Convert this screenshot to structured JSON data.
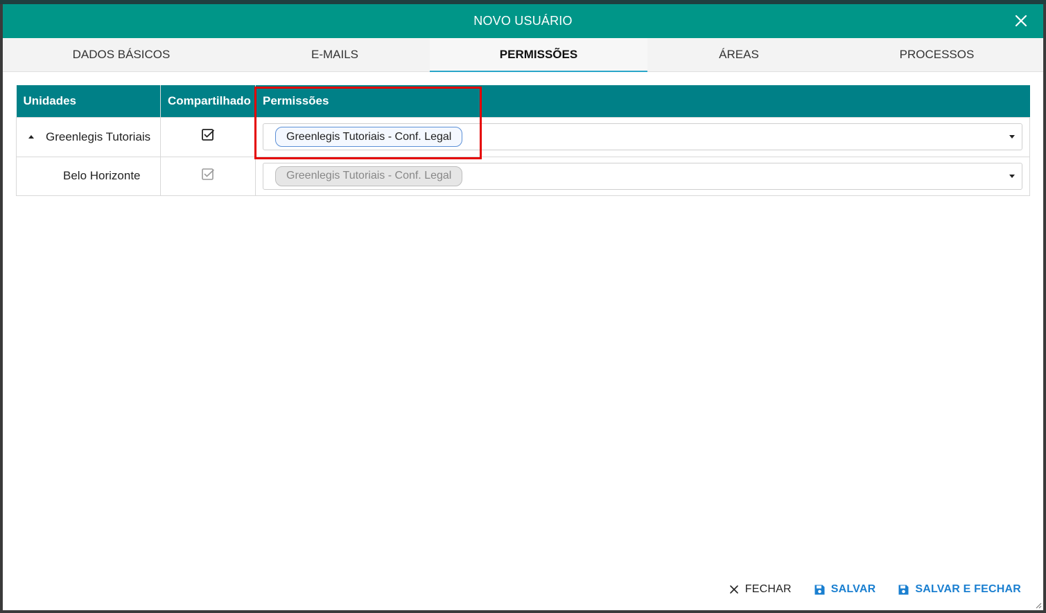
{
  "dialog": {
    "title": "NOVO USUÁRIO"
  },
  "tabs": [
    {
      "label": "DADOS BÁSICOS",
      "active": false
    },
    {
      "label": "E-MAILS",
      "active": false
    },
    {
      "label": "PERMISSÕES",
      "active": true
    },
    {
      "label": "ÁREAS",
      "active": false
    },
    {
      "label": "PROCESSOS",
      "active": false
    }
  ],
  "grid": {
    "headers": [
      "Unidades",
      "Compartilhado",
      "Permissões"
    ],
    "rows": [
      {
        "unit": "Greenlegis Tutoriais",
        "shared": true,
        "expanded": true,
        "permission": "Greenlegis Tutoriais - Conf. Legal",
        "disabled": false
      },
      {
        "unit": "Belo Horizonte",
        "shared": true,
        "expanded": false,
        "permission": "Greenlegis Tutoriais - Conf. Legal",
        "disabled": true
      }
    ]
  },
  "footer": {
    "close_label": "FECHAR",
    "save_label": "SALVAR",
    "save_close_label": "SALVAR E FECHAR"
  },
  "colors": {
    "titlebar": "#009688",
    "grid_header": "#008087",
    "active_tab_underline": "#2aa6c9",
    "primary_action": "#1a7fd0",
    "highlight": "#e50000"
  }
}
